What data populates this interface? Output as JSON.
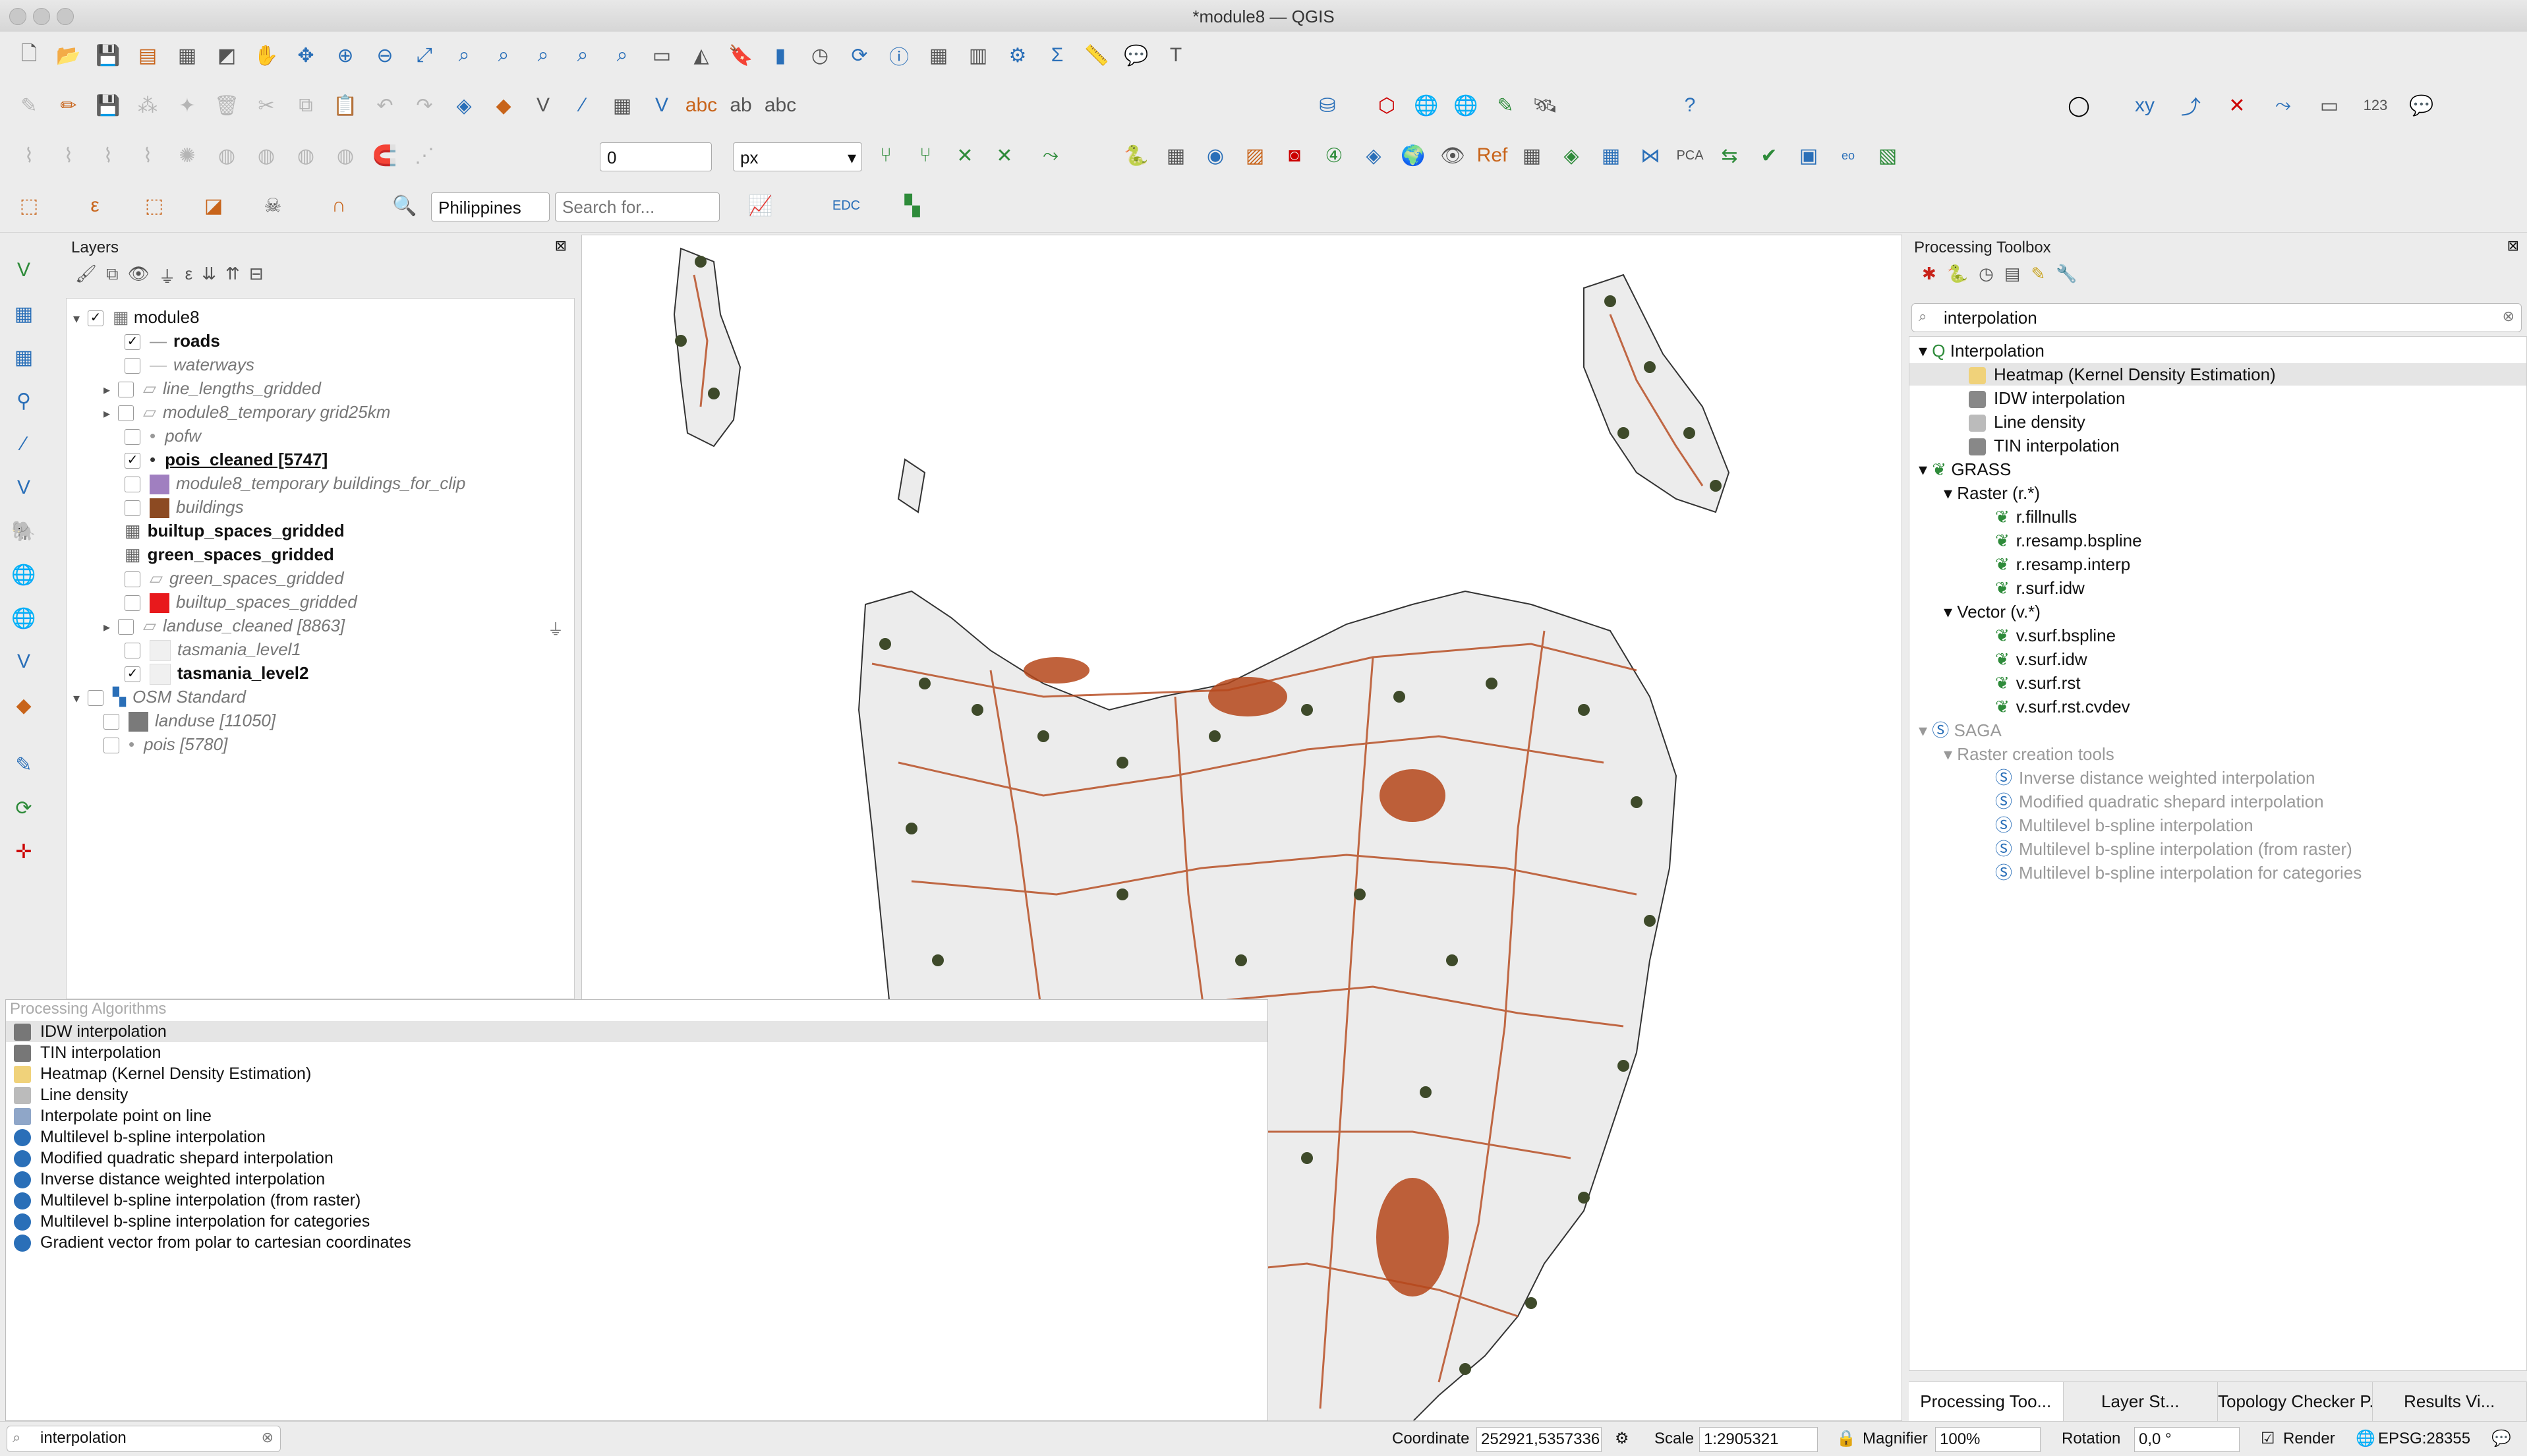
{
  "window": {
    "title": "*module8 — QGIS"
  },
  "toolbar": {
    "snap_value": "0",
    "snap_unit": "px",
    "geocoder_country": "Philippines",
    "search_placeholder": "Search for...",
    "edc_label": "EDC"
  },
  "layers_panel": {
    "title": "Layers",
    "items": [
      {
        "label": "module8",
        "checked": true,
        "style": "group"
      },
      {
        "label": "roads",
        "checked": true,
        "style": "bold"
      },
      {
        "label": "waterways",
        "checked": false,
        "style": "italic"
      },
      {
        "label": "line_lengths_gridded",
        "checked": false,
        "style": "italic"
      },
      {
        "label": "module8_temporary grid25km",
        "checked": false,
        "style": "italic"
      },
      {
        "label": "pofw",
        "checked": false,
        "style": "italic"
      },
      {
        "label": "pois_cleaned [5747]",
        "checked": true,
        "style": "bold-underline"
      },
      {
        "label": "module8_temporary buildings_for_clip",
        "checked": false,
        "style": "italic"
      },
      {
        "label": "buildings",
        "checked": false,
        "style": "italic"
      },
      {
        "label": "builtup_spaces_gridded",
        "checked": false,
        "style": "bold"
      },
      {
        "label": "green_spaces_gridded",
        "checked": false,
        "style": "bold"
      },
      {
        "label": "green_spaces_gridded",
        "checked": false,
        "style": "italic"
      },
      {
        "label": "builtup_spaces_gridded",
        "checked": false,
        "style": "italic"
      },
      {
        "label": "landuse_cleaned [8863]",
        "checked": false,
        "style": "italic"
      },
      {
        "label": "tasmania_level1",
        "checked": false,
        "style": "italic"
      },
      {
        "label": "tasmania_level2",
        "checked": true,
        "style": "bold"
      },
      {
        "label": "OSM Standard",
        "checked": false,
        "style": "italic"
      },
      {
        "label": "landuse [11050]",
        "checked": false,
        "style": "italic"
      },
      {
        "label": "pois [5780]",
        "checked": false,
        "style": "italic"
      }
    ]
  },
  "processing_toolbox": {
    "title": "Processing Toolbox",
    "search_value": "interpolation",
    "tree": [
      {
        "label": "Interpolation",
        "level": 0
      },
      {
        "label": "Heatmap (Kernel Density Estimation)",
        "level": 1
      },
      {
        "label": "IDW interpolation",
        "level": 1
      },
      {
        "label": "Line density",
        "level": 1
      },
      {
        "label": "TIN interpolation",
        "level": 1
      },
      {
        "label": "GRASS",
        "level": 0
      },
      {
        "label": "Raster (r.*)",
        "level": 1
      },
      {
        "label": "r.fillnulls",
        "level": 2
      },
      {
        "label": "r.resamp.bspline",
        "level": 2
      },
      {
        "label": "r.resamp.interp",
        "level": 2
      },
      {
        "label": "r.surf.idw",
        "level": 2
      },
      {
        "label": "Vector (v.*)",
        "level": 1
      },
      {
        "label": "v.surf.bspline",
        "level": 2
      },
      {
        "label": "v.surf.idw",
        "level": 2
      },
      {
        "label": "v.surf.rst",
        "level": 2
      },
      {
        "label": "v.surf.rst.cvdev",
        "level": 2
      },
      {
        "label": "SAGA",
        "level": 0
      },
      {
        "label": "Raster creation tools",
        "level": 1
      },
      {
        "label": "Inverse distance weighted interpolation",
        "level": 2
      },
      {
        "label": "Modified quadratic shepard interpolation",
        "level": 2
      },
      {
        "label": "Multilevel b-spline interpolation",
        "level": 2
      },
      {
        "label": "Multilevel b-spline interpolation (from raster)",
        "level": 2
      },
      {
        "label": "Multilevel b-spline interpolation for categories",
        "level": 2
      }
    ],
    "tabs": [
      "Processing Too...",
      "Layer St...",
      "Topology Checker P...",
      "Results Vi..."
    ]
  },
  "locator": {
    "header": "Processing Algorithms",
    "results": [
      "IDW interpolation",
      "TIN interpolation",
      "Heatmap (Kernel Density Estimation)",
      "Line density",
      "Interpolate point on line",
      "Multilevel b-spline interpolation",
      "Modified quadratic shepard interpolation",
      "Inverse distance weighted interpolation",
      "Multilevel b-spline interpolation (from raster)",
      "Multilevel b-spline interpolation for categories",
      "Gradient vector from polar to cartesian coordinates"
    ],
    "input_value": "interpolation"
  },
  "statusbar": {
    "coordinate_label": "Coordinate",
    "coordinate_value": "252921,5357336",
    "scale_label": "Scale",
    "scale_value": "1:2905321",
    "magnifier_label": "Magnifier",
    "magnifier_value": "100%",
    "rotation_label": "Rotation",
    "rotation_value": "0,0 °",
    "render_label": "Render",
    "crs": "EPSG:28355"
  },
  "colors": {
    "roads": "#b5461a",
    "pois": "#3e4a2a",
    "land": "#ececec"
  }
}
